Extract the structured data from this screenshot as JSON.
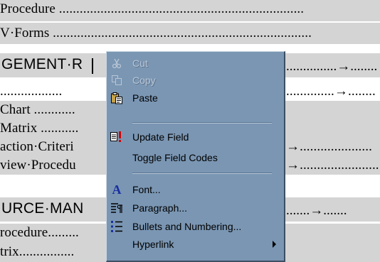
{
  "document": {
    "lines": [
      {
        "text": "Procedure ......................................................................."
      },
      {
        "text": "V·Forms ..........................................................................."
      }
    ],
    "heading1": {
      "text": "GEMENT·R",
      "dots": "...............→........"
    },
    "lines2": [
      {
        "text": "..................",
        "tail": "..............→........"
      },
      {
        "text": "Chart ............",
        "tail": ""
      },
      {
        "text": "Matrix ...........",
        "tail": ""
      },
      {
        "text": "action·Criteri",
        "tail": "→....................."
      },
      {
        "text": "view·Procedu",
        "tail": "→......................."
      }
    ],
    "heading2": {
      "text": "URCE·MAN",
      "dots": ".......→......."
    },
    "lines3": [
      {
        "text": "rocedure.........",
        "tail": ""
      },
      {
        "text": "trix................",
        "tail": ""
      }
    ]
  },
  "context_menu": {
    "items": [
      {
        "label": "Cut",
        "icon": "scissors-icon",
        "disabled": true
      },
      {
        "label": "Copy",
        "icon": "copy-icon",
        "disabled": true
      },
      {
        "label": "Paste",
        "icon": "paste-icon",
        "disabled": false
      },
      {
        "label": "Update Field",
        "icon": "update-field-icon",
        "disabled": false
      },
      {
        "label": "Toggle Field Codes",
        "icon": "",
        "disabled": false
      },
      {
        "label": "Font...",
        "icon": "font-icon",
        "disabled": false
      },
      {
        "label": "Paragraph...",
        "icon": "paragraph-icon",
        "disabled": false
      },
      {
        "label": "Bullets and Numbering...",
        "icon": "bullets-icon",
        "disabled": false
      },
      {
        "label": "Hyperlink",
        "icon": "",
        "disabled": false,
        "submenu": true
      }
    ]
  },
  "colors": {
    "menu_bg": "#7a96b3",
    "field_shading": "#d4d4d4"
  }
}
